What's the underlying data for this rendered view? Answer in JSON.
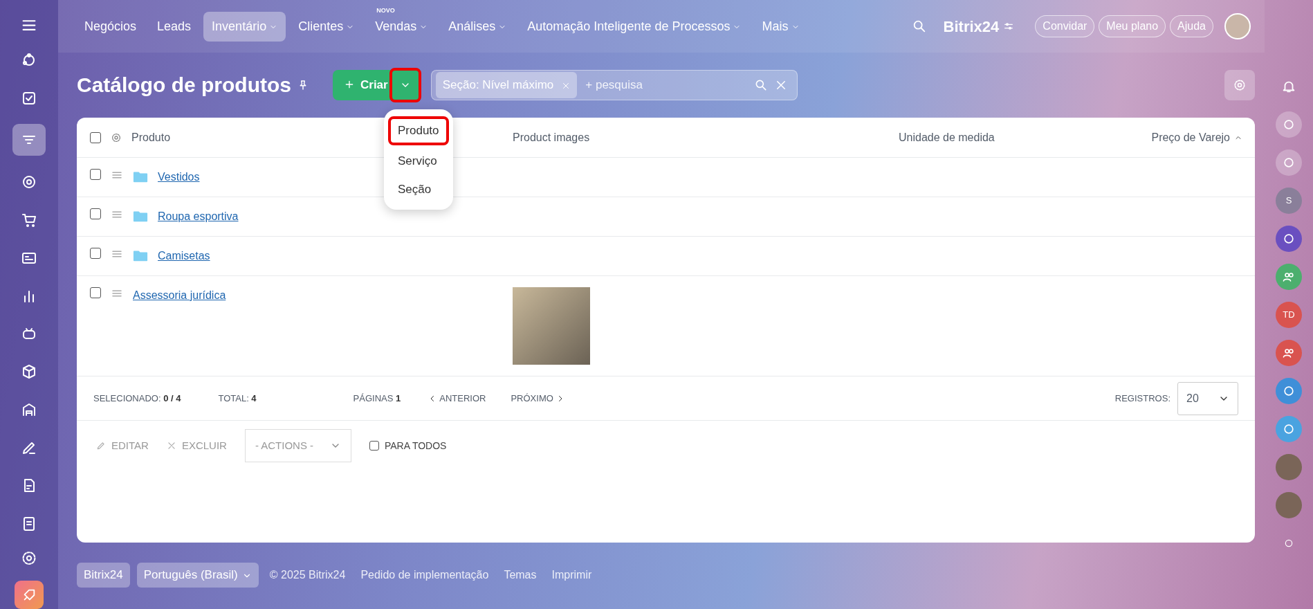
{
  "top_nav": [
    {
      "label": "Negócios",
      "selected": false,
      "caret": false
    },
    {
      "label": "Leads",
      "selected": false,
      "caret": false
    },
    {
      "label": "Inventário",
      "selected": true,
      "caret": true
    },
    {
      "label": "Clientes",
      "selected": false,
      "caret": true
    },
    {
      "label": "Vendas",
      "selected": false,
      "caret": true,
      "badge": "NOVO"
    },
    {
      "label": "Análises",
      "selected": false,
      "caret": true
    },
    {
      "label": "Automação Inteligente de Processos",
      "selected": false,
      "caret": true
    },
    {
      "label": "Mais",
      "selected": false,
      "caret": true
    }
  ],
  "brand": "Bitrix24",
  "header_buttons": [
    "Convidar",
    "Meu plano",
    "Ajuda"
  ],
  "sidebar": [
    {
      "selected": false
    },
    {
      "selected": false
    },
    {
      "selected": true
    },
    {
      "selected": false
    },
    {
      "selected": false
    },
    {
      "selected": false
    },
    {
      "selected": false
    },
    {
      "selected": false
    },
    {
      "selected": false
    },
    {
      "selected": false
    },
    {
      "selected": false
    },
    {
      "selected": false
    },
    {
      "selected": false
    }
  ],
  "right_rail": [
    {
      "kind": "bell"
    },
    {
      "kind": "icon"
    },
    {
      "kind": "icon"
    },
    {
      "kind": "initials",
      "text": "S",
      "color": "#8a7f9a"
    },
    {
      "kind": "icon",
      "color": "#6a4fc0"
    },
    {
      "kind": "person",
      "color": "#4caf6e"
    },
    {
      "kind": "initials",
      "text": "TD",
      "color": "#d9534f"
    },
    {
      "kind": "person",
      "color": "#d9534f"
    },
    {
      "kind": "icon",
      "color": "#3f8fd8"
    },
    {
      "kind": "icon",
      "color": "#4aa3e0"
    },
    {
      "kind": "photo"
    },
    {
      "kind": "photo"
    },
    {
      "kind": "dot"
    }
  ],
  "page_title": "Catálogo de produtos",
  "create_button": "Criar",
  "create_menu_highlighted": true,
  "filter": {
    "tag": "Seção: Nível máximo",
    "placeholder": "+ pesquisa"
  },
  "create_menu": [
    {
      "label": "Produto",
      "selected": true
    },
    {
      "label": "Serviço",
      "selected": false
    },
    {
      "label": "Seção",
      "selected": false
    }
  ],
  "table": {
    "select_all_checked": false,
    "columns": [
      {
        "label": "Produto",
        "sorted": false
      },
      {
        "label": "Product images",
        "sorted": false
      },
      {
        "label": "Unidade de medida",
        "sorted": false
      },
      {
        "label": "Preço de Varejo",
        "sorted": true
      }
    ],
    "rows": [
      {
        "kind": "section",
        "name": "Vestidos",
        "checked": false,
        "image": false
      },
      {
        "kind": "section",
        "name": "Roupa esportiva",
        "checked": false,
        "image": false
      },
      {
        "kind": "section",
        "name": "Camisetas",
        "checked": false,
        "image": false
      },
      {
        "kind": "product",
        "name": "Assessoria jurídica",
        "checked": false,
        "image": true
      }
    ]
  },
  "pager": {
    "selected_label": "SELECIONADO:",
    "selected_value": "0 / 4",
    "total_label": "TOTAL:",
    "total_value": "4",
    "pages_label": "PÁGINAS",
    "page": "1",
    "prev": "ANTERIOR",
    "next": "PRÓXIMO",
    "records_label": "REGISTROS:",
    "records_value": "20"
  },
  "actions": {
    "edit": "EDITAR",
    "delete": "EXCLUIR",
    "select": "- ACTIONS -",
    "for_all": "PARA TODOS",
    "for_all_checked": false
  },
  "footer": {
    "brand": "Bitrix24",
    "language": "Português (Brasil)",
    "copyright": "© 2025 Bitrix24",
    "links": [
      "Pedido de implementação",
      "Temas",
      "Imprimir"
    ]
  }
}
